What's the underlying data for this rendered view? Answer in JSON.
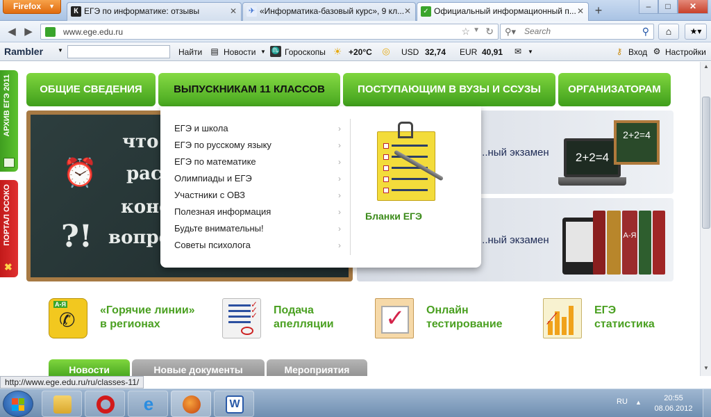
{
  "browser": {
    "menu_button": "Firefox",
    "tabs": [
      {
        "title": "ЕГЭ по информатике: отзывы",
        "favicon_color": "#222222"
      },
      {
        "title": "«Информатика-базовый курс», 9 кл...",
        "favicon_color": "#3a6fd0"
      },
      {
        "title": "Официальный информационный п...",
        "favicon_color": "#3aa52c"
      }
    ],
    "new_tab": "+",
    "window_controls": {
      "minimize": "–",
      "maximize": "□",
      "close": "✕"
    },
    "url": "www.ege.edu.ru",
    "search_placeholder": "Search",
    "status_url": "http://www.ege.edu.ru/ru/classes-11/"
  },
  "rambler_bar": {
    "logo": "Rambler",
    "find": "Найти",
    "news": "Новости",
    "horoscopes": "Гороскопы",
    "weather": "+20°C",
    "usd_label": "USD",
    "usd_value": "32,74",
    "eur_label": "EUR",
    "eur_value": "40,91",
    "login": "Вход",
    "settings": "Настройки"
  },
  "side_tabs": {
    "archive": "АРХИВ ЕГЭ 2011",
    "portal": "ПОРТАЛ ОСОКО"
  },
  "main_menu": [
    {
      "label": "ОБЩИЕ СВЕДЕНИЯ"
    },
    {
      "label": "ВЫПУСКНИКАМ 11 КЛАССОВ"
    },
    {
      "label": "ПОСТУПАЮЩИМ В ВУЗЫ И ССУЗЫ"
    },
    {
      "label": "ОРГАНИЗАТОРАМ"
    }
  ],
  "chalkboard": {
    "lines": [
      "что",
      "распи",
      "конс",
      "вопро"
    ]
  },
  "banners": [
    {
      "text": "...ный экзамен",
      "board_text": "2+2=4",
      "laptop_text": "2+2=4"
    },
    {
      "text": "...ный экзамен",
      "book_text": "А-Я"
    }
  ],
  "dropdown": {
    "items": [
      {
        "label": "ЕГЭ и школа"
      },
      {
        "label": "ЕГЭ по русскому языку"
      },
      {
        "label": "ЕГЭ по математике"
      },
      {
        "label": "Олимпиады и ЕГЭ"
      },
      {
        "label": "Участники с ОВЗ"
      },
      {
        "label": "Полезная информация"
      },
      {
        "label": "Будьте внимательны!"
      },
      {
        "label": "Советы психолога"
      }
    ],
    "feature_label": "Бланки ЕГЭ"
  },
  "features": [
    {
      "line1": "«Горячие линии»",
      "line2": "в регионах",
      "icon_text": "А-Я"
    },
    {
      "line1": "Подача",
      "line2": "апелляции"
    },
    {
      "line1": "Онлайн",
      "line2": "тестирование"
    },
    {
      "line1": "ЕГЭ",
      "line2": "статистика"
    }
  ],
  "news_tabs": [
    {
      "label": "Новости"
    },
    {
      "label": "Новые документы"
    },
    {
      "label": "Мероприятия"
    }
  ],
  "taskbar": {
    "lang": "RU",
    "time": "20:55",
    "date": "08.06.2012"
  },
  "colors": {
    "green_accent": "#4aa021",
    "portal_red": "#d42222"
  }
}
